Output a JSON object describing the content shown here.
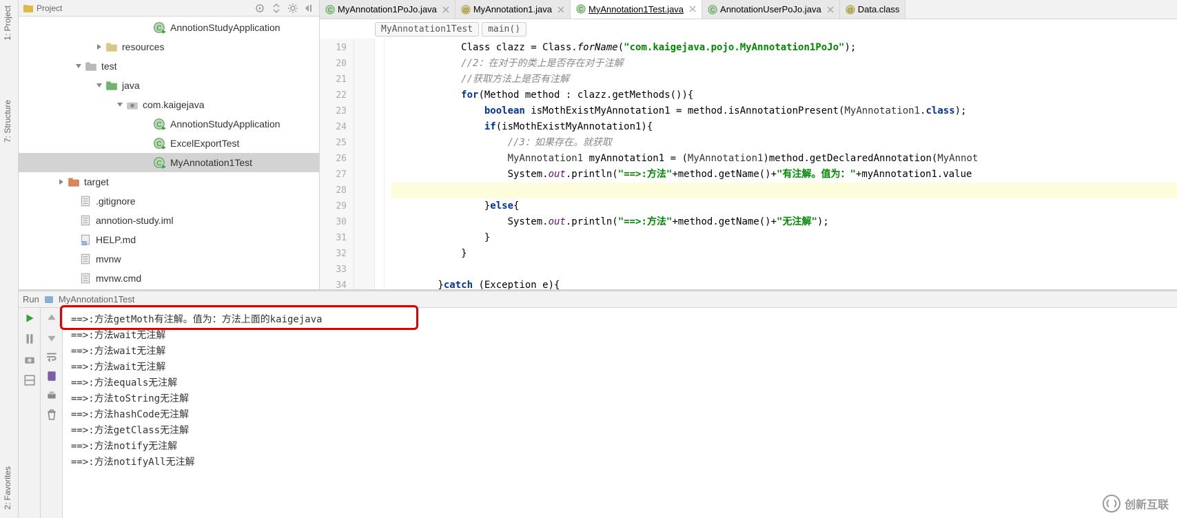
{
  "leftTabs": {
    "project": "1: Project",
    "structure": "7: Structure",
    "favorites": "2: Favorites"
  },
  "projectPanel": {
    "title": "Project",
    "tree": [
      {
        "indent": 180,
        "arrow": "none",
        "icon": "class-run",
        "label": "AnnotionStudyApplication",
        "selected": false
      },
      {
        "indent": 110,
        "arrow": "right",
        "icon": "folder-res",
        "label": "resources",
        "selected": false
      },
      {
        "indent": 80,
        "arrow": "down",
        "icon": "folder",
        "label": "test",
        "selected": false
      },
      {
        "indent": 110,
        "arrow": "down",
        "icon": "folder-src",
        "label": "java",
        "selected": false
      },
      {
        "indent": 140,
        "arrow": "down",
        "icon": "package",
        "label": "com.kaigejava",
        "selected": false
      },
      {
        "indent": 180,
        "arrow": "none",
        "icon": "class-run",
        "label": "AnnotionStudyApplication",
        "selected": false
      },
      {
        "indent": 180,
        "arrow": "none",
        "icon": "class-run",
        "label": "ExcelExportTest",
        "selected": false
      },
      {
        "indent": 180,
        "arrow": "none",
        "icon": "class-run",
        "label": "MyAnnotation1Test",
        "selected": true
      },
      {
        "indent": 55,
        "arrow": "right",
        "icon": "folder-exc",
        "label": "target",
        "selected": false
      },
      {
        "indent": 72,
        "arrow": "none",
        "icon": "file",
        "label": ".gitignore",
        "selected": false
      },
      {
        "indent": 72,
        "arrow": "none",
        "icon": "file",
        "label": "annotion-study.iml",
        "selected": false
      },
      {
        "indent": 72,
        "arrow": "none",
        "icon": "file-md",
        "label": "HELP.md",
        "selected": false
      },
      {
        "indent": 72,
        "arrow": "none",
        "icon": "file",
        "label": "mvnw",
        "selected": false
      },
      {
        "indent": 72,
        "arrow": "none",
        "icon": "file",
        "label": "mvnw.cmd",
        "selected": false
      }
    ]
  },
  "editorTabs": [
    {
      "icon": "class",
      "label": "MyAnnotation1PoJo.java",
      "active": false
    },
    {
      "icon": "anno",
      "label": "MyAnnotation1.java",
      "active": false
    },
    {
      "icon": "class",
      "label": "MyAnnotation1Test.java",
      "active": true,
      "underlined": true
    },
    {
      "icon": "class",
      "label": "AnnotationUserPoJo.java",
      "active": false
    },
    {
      "icon": "anno",
      "label": "Data.class",
      "active": false,
      "noclose": true
    }
  ],
  "breadcrumb": [
    "MyAnnotation1Test",
    "main()"
  ],
  "code": {
    "startLine": 19,
    "lines": [
      {
        "n": 19,
        "html": "            Class clazz = Class.<span class='st'>forName</span>(<span class='str'>\"com.kaigejava.pojo.MyAnnotation1PoJo\"</span>);"
      },
      {
        "n": 20,
        "html": "            <span class='cm'>//2：在对于的类上是否存在对于注解</span>"
      },
      {
        "n": 21,
        "html": "            <span class='cm'>//获取方法上是否有注解</span>"
      },
      {
        "n": 22,
        "html": "            <span class='kw'>for</span>(Method method : clazz.getMethods()){"
      },
      {
        "n": 23,
        "html": "                <span class='kw'>boolean</span> isMothExistMyAnnotation1 = method.isAnnotationPresent(<span class='cls'>MyAnnotation1</span>.<span class='kw'>class</span>);"
      },
      {
        "n": 24,
        "html": "                <span class='kw'>if</span>(isMothExistMyAnnotation1){"
      },
      {
        "n": 25,
        "html": "                    <span class='cm'>//3：如果存在。就获取</span>"
      },
      {
        "n": 26,
        "html": "                    <span class='cls'>MyAnnotation1</span> myAnnotation1 = (<span class='cls'>MyAnnotation1</span>)method.getDeclaredAnnotation(<span class='cls'>MyAnnot</span>"
      },
      {
        "n": 27,
        "html": "                    System.<span class='fld st'>out</span>.println(<span class='str'>\"==>:方法\"</span>+method.getName()+<span class='str'>\"有注解。值为：\"</span>+myAnnotation1.value"
      },
      {
        "n": 28,
        "html": "",
        "hl": true
      },
      {
        "n": 29,
        "html": "                }<span class='kw'>else</span>{"
      },
      {
        "n": 30,
        "html": "                    System.<span class='fld st'>out</span>.println(<span class='str'>\"==>:方法\"</span>+method.getName()+<span class='str'>\"无注解\"</span>);"
      },
      {
        "n": 31,
        "html": "                }"
      },
      {
        "n": 32,
        "html": "            }"
      },
      {
        "n": 33,
        "html": ""
      },
      {
        "n": 34,
        "html": "        }<span class='kw'>catch</span> (Exception e){"
      }
    ]
  },
  "run": {
    "label": "Run",
    "config": "MyAnnotation1Test",
    "console": [
      "==>:方法getMoth有注解。值为：方法上面的kaigejava",
      "==>:方法wait无注解",
      "==>:方法wait无注解",
      "==>:方法wait无注解",
      "==>:方法equals无注解",
      "==>:方法toString无注解",
      "==>:方法hashCode无注解",
      "==>:方法getClass无注解",
      "==>:方法notify无注解",
      "==>:方法notifyAll无注解"
    ]
  },
  "watermark": "创新互联"
}
